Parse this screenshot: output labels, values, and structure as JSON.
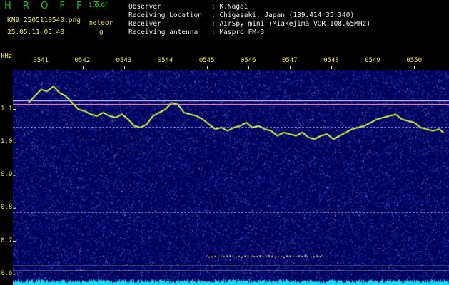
{
  "header": {
    "brand": "H R O F F T",
    "version": "1.0.0f",
    "filename": "KN9_2505110540.png",
    "datetime": "25.05.11 05:40",
    "meteor_label": "meteor",
    "meteor_count": "0",
    "info": [
      {
        "label": "Observer",
        "value": ": K.Nagai"
      },
      {
        "label": "Receiving Location",
        "value": ": Chigasaki, Japan (139.414 35.340)"
      },
      {
        "label": "Receiver",
        "value": ": AirSpy mini (Miakejima VOR 108.65MHz)"
      },
      {
        "label": "Receiving antenna",
        "value": ": Maspro FM-3"
      }
    ]
  },
  "colors": {
    "background": "#00005a",
    "trace": "#f2e24a",
    "noise_floor": "#20d8f0",
    "axis_text": "#f0f040"
  },
  "chart_data": {
    "type": "line",
    "title": "",
    "xlabel": "",
    "ylabel": "kHz",
    "x_ticks": [
      "0541",
      "0542",
      "0543",
      "0544",
      "0545",
      "0546",
      "0547",
      "0548",
      "0549",
      "0550"
    ],
    "y_ticks": [
      "1.1",
      "1.0",
      "0.9",
      "0.8",
      "0.7",
      "0.6"
    ],
    "ylim": [
      0.58,
      1.22
    ],
    "xlim": [
      0,
      10
    ],
    "horizontal_lines_khz": [
      1.115,
      1.126,
      1.046,
      0.787,
      0.625,
      0.61
    ],
    "series": [
      {
        "x": [
          0,
          0.15,
          0.3,
          0.45,
          0.6,
          0.75,
          0.9,
          1.05,
          1.2,
          1.35,
          1.5,
          1.65,
          1.8,
          1.95,
          2.1,
          2.25,
          2.4,
          2.55,
          2.7,
          2.85,
          3.0,
          3.15,
          3.3,
          3.45,
          3.6,
          3.75,
          3.9,
          4.05,
          4.2,
          4.35,
          4.5,
          4.65,
          4.8,
          4.95,
          5.1,
          5.25,
          5.4,
          5.55,
          5.7,
          5.85,
          6.0,
          6.15,
          6.3,
          6.45,
          6.6,
          6.75,
          6.9,
          7.05,
          7.2,
          7.35,
          7.5,
          7.65,
          7.8,
          7.95,
          8.1,
          8.25,
          8.4,
          8.55,
          8.7,
          8.85,
          9.0,
          9.15,
          9.3,
          9.45,
          9.6,
          9.75,
          9.9,
          10.0
        ],
        "values": [
          1.12,
          1.14,
          1.16,
          1.155,
          1.17,
          1.15,
          1.14,
          1.12,
          1.1,
          1.095,
          1.085,
          1.08,
          1.09,
          1.08,
          1.075,
          1.085,
          1.07,
          1.05,
          1.045,
          1.055,
          1.08,
          1.09,
          1.1,
          1.12,
          1.115,
          1.09,
          1.085,
          1.08,
          1.07,
          1.055,
          1.04,
          1.045,
          1.035,
          1.045,
          1.05,
          1.06,
          1.045,
          1.05,
          1.04,
          1.035,
          1.02,
          1.03,
          1.025,
          1.02,
          1.03,
          1.015,
          1.01,
          1.02,
          1.025,
          1.01,
          1.02,
          1.03,
          1.04,
          1.045,
          1.05,
          1.06,
          1.07,
          1.075,
          1.08,
          1.085,
          1.07,
          1.065,
          1.06,
          1.045,
          1.04,
          1.035,
          1.04,
          1.03
        ]
      }
    ]
  }
}
